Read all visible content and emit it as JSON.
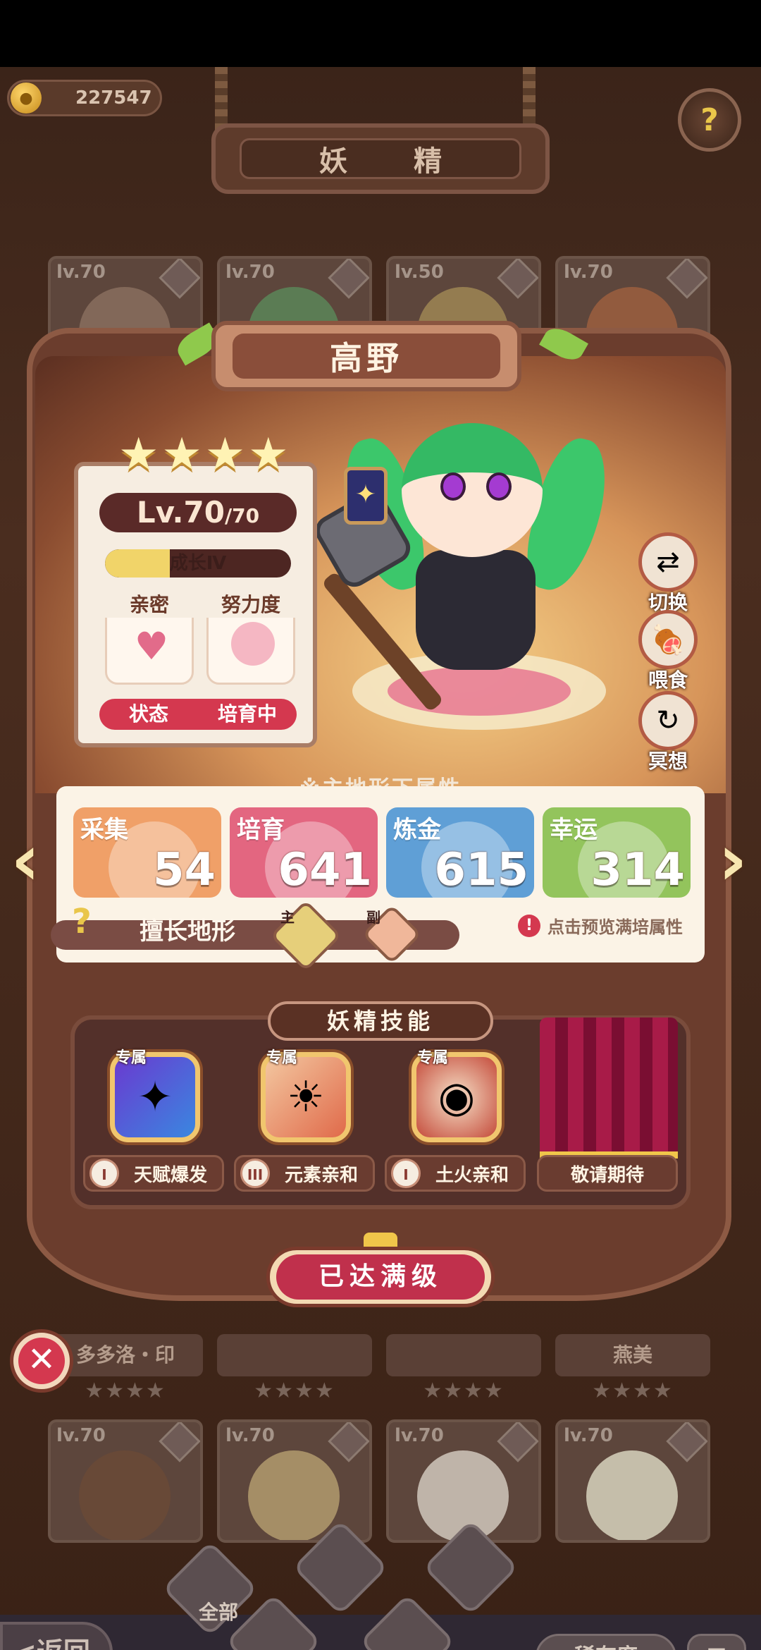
{
  "currency": {
    "value": "227547",
    "icon": "coin-icon"
  },
  "header": {
    "title": "妖 精",
    "help_icon": "question-icon"
  },
  "background_cards": {
    "top": [
      {
        "level": "lv.70"
      },
      {
        "level": "lv.70"
      },
      {
        "level": "lv.50"
      },
      {
        "level": "lv.70"
      }
    ],
    "names": [
      "多多洛・印",
      "",
      "",
      "燕美"
    ],
    "bottom": [
      {
        "level": "lv.70"
      },
      {
        "level": "lv.70"
      },
      {
        "level": "lv.70"
      },
      {
        "level": "lv.70"
      }
    ]
  },
  "character": {
    "name": "高野",
    "stars": 4,
    "level": "Lv.70",
    "level_max": "/70",
    "growth": {
      "label": "成长Ⅳ",
      "progress": 0.35
    },
    "intimacy_label": "亲密",
    "effort_label": "努力度",
    "status_label": "状态",
    "status_value": "培育中"
  },
  "side_actions": [
    {
      "label": "切换",
      "icon": "switch-icon"
    },
    {
      "label": "喂食",
      "icon": "meat-icon"
    },
    {
      "label": "冥想",
      "icon": "meditate-icon"
    }
  ],
  "attributes": {
    "note": "※主地形下属性",
    "items": [
      {
        "label": "采集",
        "value": "54",
        "color": "#f0a068"
      },
      {
        "label": "培育",
        "value": "641",
        "color": "#e36680"
      },
      {
        "label": "炼金",
        "value": "615",
        "color": "#5f9fd6"
      },
      {
        "label": "幸运",
        "value": "314",
        "color": "#93c45c"
      }
    ],
    "terrain_label": "擅长地形",
    "terrain_main_mark": "主",
    "terrain_sub_mark": "副",
    "preview_label": "点击预览满培属性"
  },
  "skills": {
    "title": "妖精技能",
    "items": [
      {
        "tag": "专属",
        "rank": "I",
        "name": "天赋爆发",
        "icon": "talent-burst-icon"
      },
      {
        "tag": "专属",
        "rank": "III",
        "name": "元素亲和",
        "icon": "element-affinity-icon"
      },
      {
        "tag": "专属",
        "rank": "I",
        "name": "土火亲和",
        "icon": "earth-fire-affinity-icon"
      }
    ],
    "coming_soon": "敬请期待"
  },
  "max_level_button": "已达满级",
  "bottom_nav": {
    "back": "<返回",
    "filter_all": "全部",
    "rarity": "稀有度"
  }
}
